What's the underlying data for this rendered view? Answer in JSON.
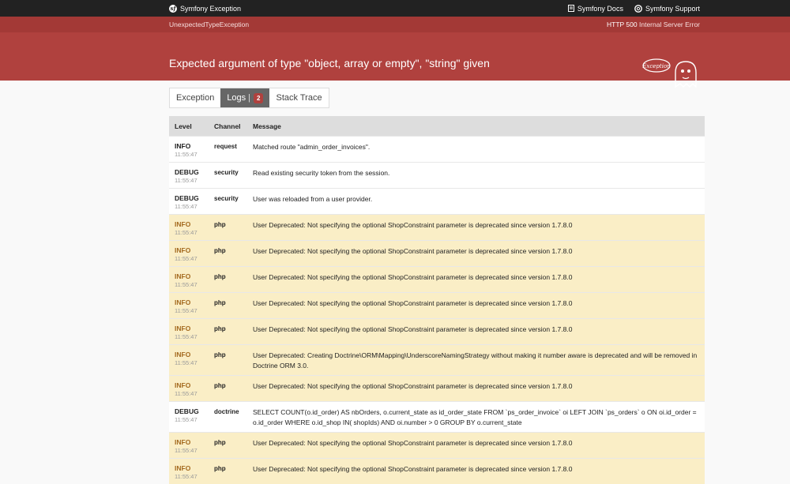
{
  "topbar": {
    "brand": "Symfony Exception",
    "docs": "Symfony Docs",
    "support": "Symfony Support"
  },
  "header": {
    "exception_class": "UnexpectedTypeException",
    "status_code": "HTTP 500",
    "status_text": "Internal Server Error",
    "message": "Expected argument of type \"object, array or empty\", \"string\" given",
    "ghost_text": "Exception"
  },
  "tabs": [
    {
      "label": "Exception"
    },
    {
      "label": "Logs",
      "badge": "2"
    },
    {
      "label": "Stack Trace"
    }
  ],
  "table": {
    "headers": [
      "Level",
      "Channel",
      "Message"
    ],
    "rows": [
      {
        "level": "INFO",
        "time": "11:55:47",
        "channel": "request",
        "message": "Matched route \"admin_order_invoices\".",
        "highlight": false
      },
      {
        "level": "DEBUG",
        "time": "11:55:47",
        "channel": "security",
        "message": "Read existing security token from the session.",
        "highlight": false
      },
      {
        "level": "DEBUG",
        "time": "11:55:47",
        "channel": "security",
        "message": "User was reloaded from a user provider.",
        "highlight": false
      },
      {
        "level": "INFO",
        "time": "11:55:47",
        "channel": "php",
        "message": "User Deprecated: Not specifying the optional ShopConstraint parameter is deprecated since version 1.7.8.0",
        "highlight": true
      },
      {
        "level": "INFO",
        "time": "11:55:47",
        "channel": "php",
        "message": "User Deprecated: Not specifying the optional ShopConstraint parameter is deprecated since version 1.7.8.0",
        "highlight": true
      },
      {
        "level": "INFO",
        "time": "11:55:47",
        "channel": "php",
        "message": "User Deprecated: Not specifying the optional ShopConstraint parameter is deprecated since version 1.7.8.0",
        "highlight": true
      },
      {
        "level": "INFO",
        "time": "11:55:47",
        "channel": "php",
        "message": "User Deprecated: Not specifying the optional ShopConstraint parameter is deprecated since version 1.7.8.0",
        "highlight": true
      },
      {
        "level": "INFO",
        "time": "11:55:47",
        "channel": "php",
        "message": "User Deprecated: Not specifying the optional ShopConstraint parameter is deprecated since version 1.7.8.0",
        "highlight": true
      },
      {
        "level": "INFO",
        "time": "11:55:47",
        "channel": "php",
        "message": "User Deprecated: Creating Doctrine\\ORM\\Mapping\\UnderscoreNamingStrategy without making it number aware is deprecated and will be removed in Doctrine ORM 3.0.",
        "highlight": true
      },
      {
        "level": "INFO",
        "time": "11:55:47",
        "channel": "php",
        "message": "User Deprecated: Not specifying the optional ShopConstraint parameter is deprecated since version 1.7.8.0",
        "highlight": true
      },
      {
        "level": "DEBUG",
        "time": "11:55:47",
        "channel": "doctrine",
        "message": "SELECT COUNT(o.id_order) AS nbOrders, o.current_state as id_order_state FROM `ps_order_invoice` oi LEFT JOIN `ps_orders` o ON oi.id_order = o.id_order WHERE o.id_shop IN( shopIds) AND oi.number > 0 GROUP BY o.current_state",
        "highlight": false
      },
      {
        "level": "INFO",
        "time": "11:55:47",
        "channel": "php",
        "message": "User Deprecated: Not specifying the optional ShopConstraint parameter is deprecated since version 1.7.8.0",
        "highlight": true
      },
      {
        "level": "INFO",
        "time": "11:55:47",
        "channel": "php",
        "message": "User Deprecated: Not specifying the optional ShopConstraint parameter is deprecated since version 1.7.8.0",
        "highlight": true
      }
    ]
  },
  "colors": {
    "header": "#b0413e",
    "highlight_row": "#faeec6",
    "topbar": "#222222"
  }
}
